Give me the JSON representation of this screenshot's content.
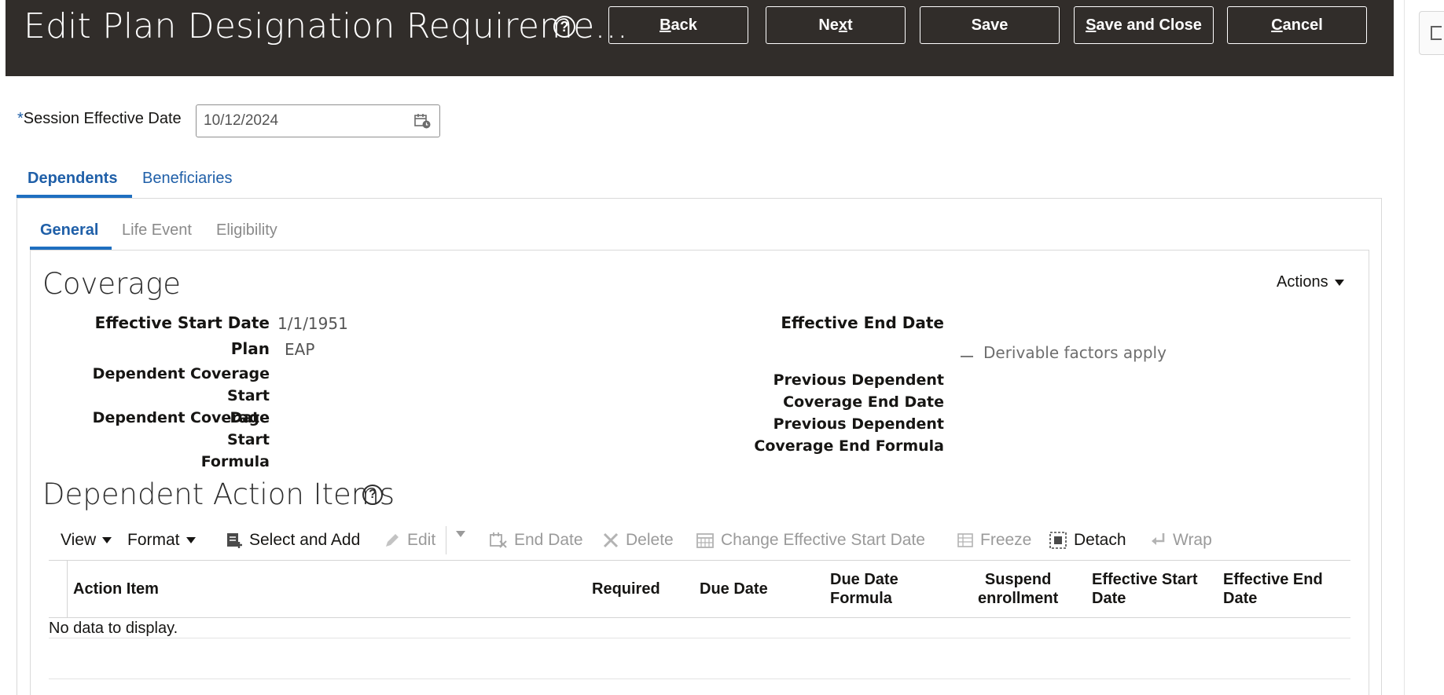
{
  "header": {
    "title": "Edit Plan Designation Requireme...",
    "help": "?",
    "buttons": {
      "back": {
        "underlined": "B",
        "rest": "ack"
      },
      "next": {
        "pre": "Ne",
        "underlined": "x",
        "rest": "t"
      },
      "save": "Save",
      "save_and_close": {
        "underlined": "S",
        "rest": "ave and Close"
      },
      "cancel": {
        "underlined": "C",
        "rest": "ancel"
      }
    }
  },
  "session": {
    "required_marker": "*",
    "label": "Session Effective Date",
    "value": "10/12/2024"
  },
  "tabs": [
    "Dependents",
    "Beneficiaries"
  ],
  "subtabs": [
    "General",
    "Life Event",
    "Eligibility"
  ],
  "coverage": {
    "title": "Coverage",
    "actions_label": "Actions",
    "effective_start_date_label": "Effective Start Date",
    "effective_start_date_value": "1/1/1951",
    "plan_label": "Plan",
    "plan_value": "EAP",
    "dep_cov_start_date_label_1": "Dependent Coverage Start",
    "dep_cov_start_date_label_2": "Date",
    "dep_cov_start_formula_label_1": "Dependent Coverage Start",
    "dep_cov_start_formula_label_2": "Formula",
    "effective_end_date_label": "Effective End Date",
    "derivable_factors": "Derivable factors apply",
    "prev_dep_cov_end_date_label_1": "Previous Dependent",
    "prev_dep_cov_end_date_label_2": "Coverage End Date",
    "prev_dep_cov_end_formula_label_1": "Previous Dependent",
    "prev_dep_cov_end_formula_label_2": "Coverage End Formula"
  },
  "action_items": {
    "title": "Dependent Action Items",
    "help": "?",
    "toolbar": {
      "view": "View",
      "format": "Format",
      "select_and_add": "Select and Add",
      "edit": "Edit",
      "end_date": "End Date",
      "delete": "Delete",
      "change_effective_start_date": "Change Effective Start Date",
      "freeze": "Freeze",
      "detach": "Detach",
      "wrap": "Wrap"
    },
    "columns": {
      "action_item": "Action Item",
      "required": "Required",
      "due_date": "Due Date",
      "due_date_formula_1": "Due Date",
      "due_date_formula_2": "Formula",
      "suspend_enrollment_1": "Suspend",
      "suspend_enrollment_2": "enrollment",
      "effective_start_date_1": "Effective Start",
      "effective_start_date_2": "Date",
      "effective_end_date_1": "Effective End",
      "effective_end_date_2": "Date"
    },
    "empty_message": "No data to display."
  },
  "colors": {
    "header_bg": "#312d2a",
    "accent": "#1f5fa8"
  }
}
